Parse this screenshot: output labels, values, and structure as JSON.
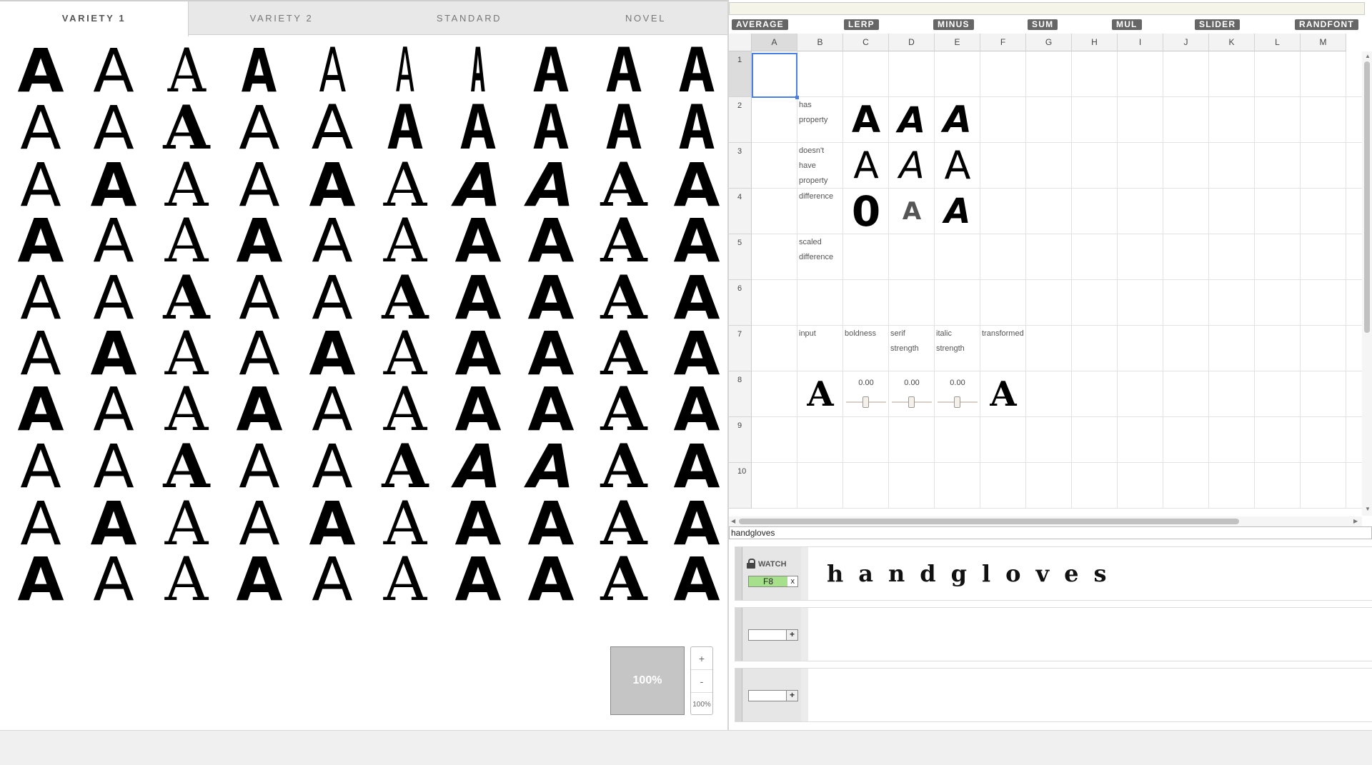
{
  "tabs": [
    {
      "label": "VARIETY 1",
      "active": true
    },
    {
      "label": "VARIETY 2",
      "active": false
    },
    {
      "label": "STANDARD",
      "active": false
    },
    {
      "label": "NOVEL",
      "active": false
    }
  ],
  "glyph_grid": {
    "character": "A",
    "rows": 10,
    "columns": 10
  },
  "zoom": {
    "thumbnail_label": "100%",
    "plus_label": "+",
    "minus_label": "-",
    "level_label": "100%"
  },
  "function_buttons": [
    "AVERAGE",
    "LERP",
    "MINUS",
    "SUM",
    "MUL",
    "SLIDER",
    "RANDFONT"
  ],
  "sheet": {
    "columns": [
      "A",
      "B",
      "C",
      "D",
      "E",
      "F",
      "G",
      "H",
      "I",
      "J",
      "K",
      "L",
      "M"
    ],
    "rows": [
      "1",
      "2",
      "3",
      "4",
      "5",
      "6",
      "7",
      "8",
      "9",
      "10"
    ],
    "selected_cell": "A1",
    "cells": {
      "B2": "has property",
      "B3": "doesn't have property",
      "B4": "difference",
      "B5": "scaled difference",
      "B7": "input",
      "C7": "boldness",
      "D7": "serif strength",
      "E7": "italic strength",
      "F7": "transformed"
    },
    "glyph_cells": {
      "C2": "A",
      "D2": "A",
      "E2": "A",
      "C3": "A",
      "D3": "A",
      "E3": "A",
      "C4": "0",
      "D4": "A",
      "E4": "A",
      "B8": "A",
      "F8": "A"
    },
    "sliders": {
      "C8": "0.00",
      "D8": "0.00",
      "E8": "0.00"
    }
  },
  "sample_text_input": "handgloves",
  "watch_panels": [
    {
      "label": "WATCH",
      "cell": "F8",
      "close": "x",
      "preview": "handgloves"
    },
    {
      "cell": "",
      "add": "+"
    },
    {
      "cell": "",
      "add": "+"
    }
  ]
}
